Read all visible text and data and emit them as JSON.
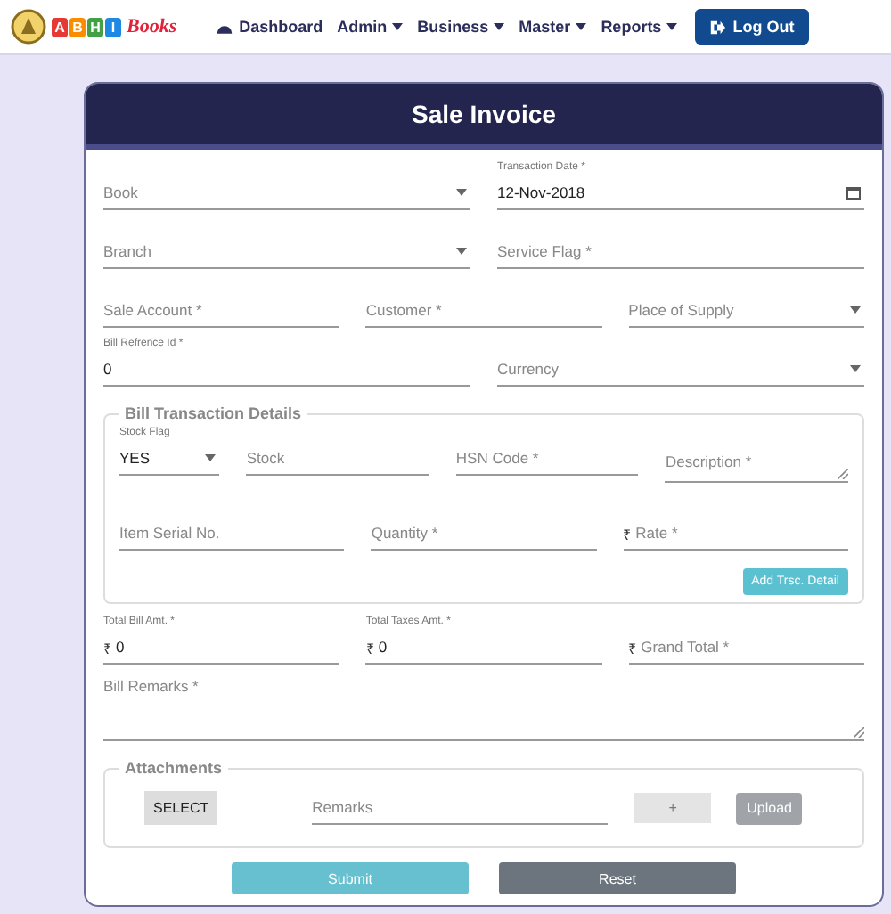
{
  "nav": {
    "logo": {
      "letters": [
        "A",
        "B",
        "H",
        "I"
      ],
      "script": "Books"
    },
    "items": [
      {
        "label": "Dashboard",
        "kind": "icon"
      },
      {
        "label": "Admin",
        "kind": "menu"
      },
      {
        "label": "Business",
        "kind": "menu"
      },
      {
        "label": "Master",
        "kind": "menu"
      },
      {
        "label": "Reports",
        "kind": "menu"
      }
    ],
    "logout": "Log Out"
  },
  "title": "Sale Invoice",
  "rows": [
    [
      {
        "label": "Book",
        "kind": "select"
      },
      {
        "label": "Transaction Date *",
        "value": "12-Nov-2018",
        "kind": "date"
      }
    ],
    [
      {
        "label": "Branch",
        "kind": "select"
      },
      {
        "label": "Service Flag *",
        "kind": "text"
      }
    ],
    [
      {
        "label": "Sale Account *",
        "kind": "text"
      },
      {
        "label": "Customer *",
        "kind": "text"
      },
      {
        "label": "Place of Supply",
        "kind": "select"
      }
    ],
    [
      {
        "label": "Bill Refrence Id *",
        "value": "0",
        "kind": "text"
      },
      {
        "label": "Currency",
        "kind": "select"
      }
    ]
  ],
  "details": {
    "legend": "Bill Transaction Details",
    "rows": [
      [
        {
          "label": "Stock Flag",
          "value": "YES",
          "kind": "select"
        },
        {
          "label": "Stock",
          "kind": "text"
        },
        {
          "label": "HSN Code *",
          "kind": "text"
        },
        {
          "label": "Description *",
          "kind": "textarea"
        }
      ],
      [
        {
          "label": "Item Serial No.",
          "kind": "text"
        },
        {
          "label": "Quantity *",
          "kind": "text"
        },
        {
          "label": "Rate *",
          "prefix": "₹",
          "kind": "text"
        }
      ]
    ],
    "button": "Add Trsc. Detail"
  },
  "totals": [
    {
      "label": "Total Bill Amt. *",
      "prefix": "₹",
      "value": "0"
    },
    {
      "label": "Total Taxes Amt. *",
      "prefix": "₹",
      "value": "0"
    },
    {
      "label": "Grand Total *",
      "prefix": "₹"
    }
  ],
  "remarks": {
    "label": "Bill Remarks *",
    "kind": "textarea"
  },
  "attachments": {
    "legend": "Attachments",
    "select": "SELECT",
    "remarks": "Remarks",
    "add": "+",
    "upload": "Upload"
  },
  "buttons": {
    "submit": "Submit",
    "reset": "Reset"
  }
}
